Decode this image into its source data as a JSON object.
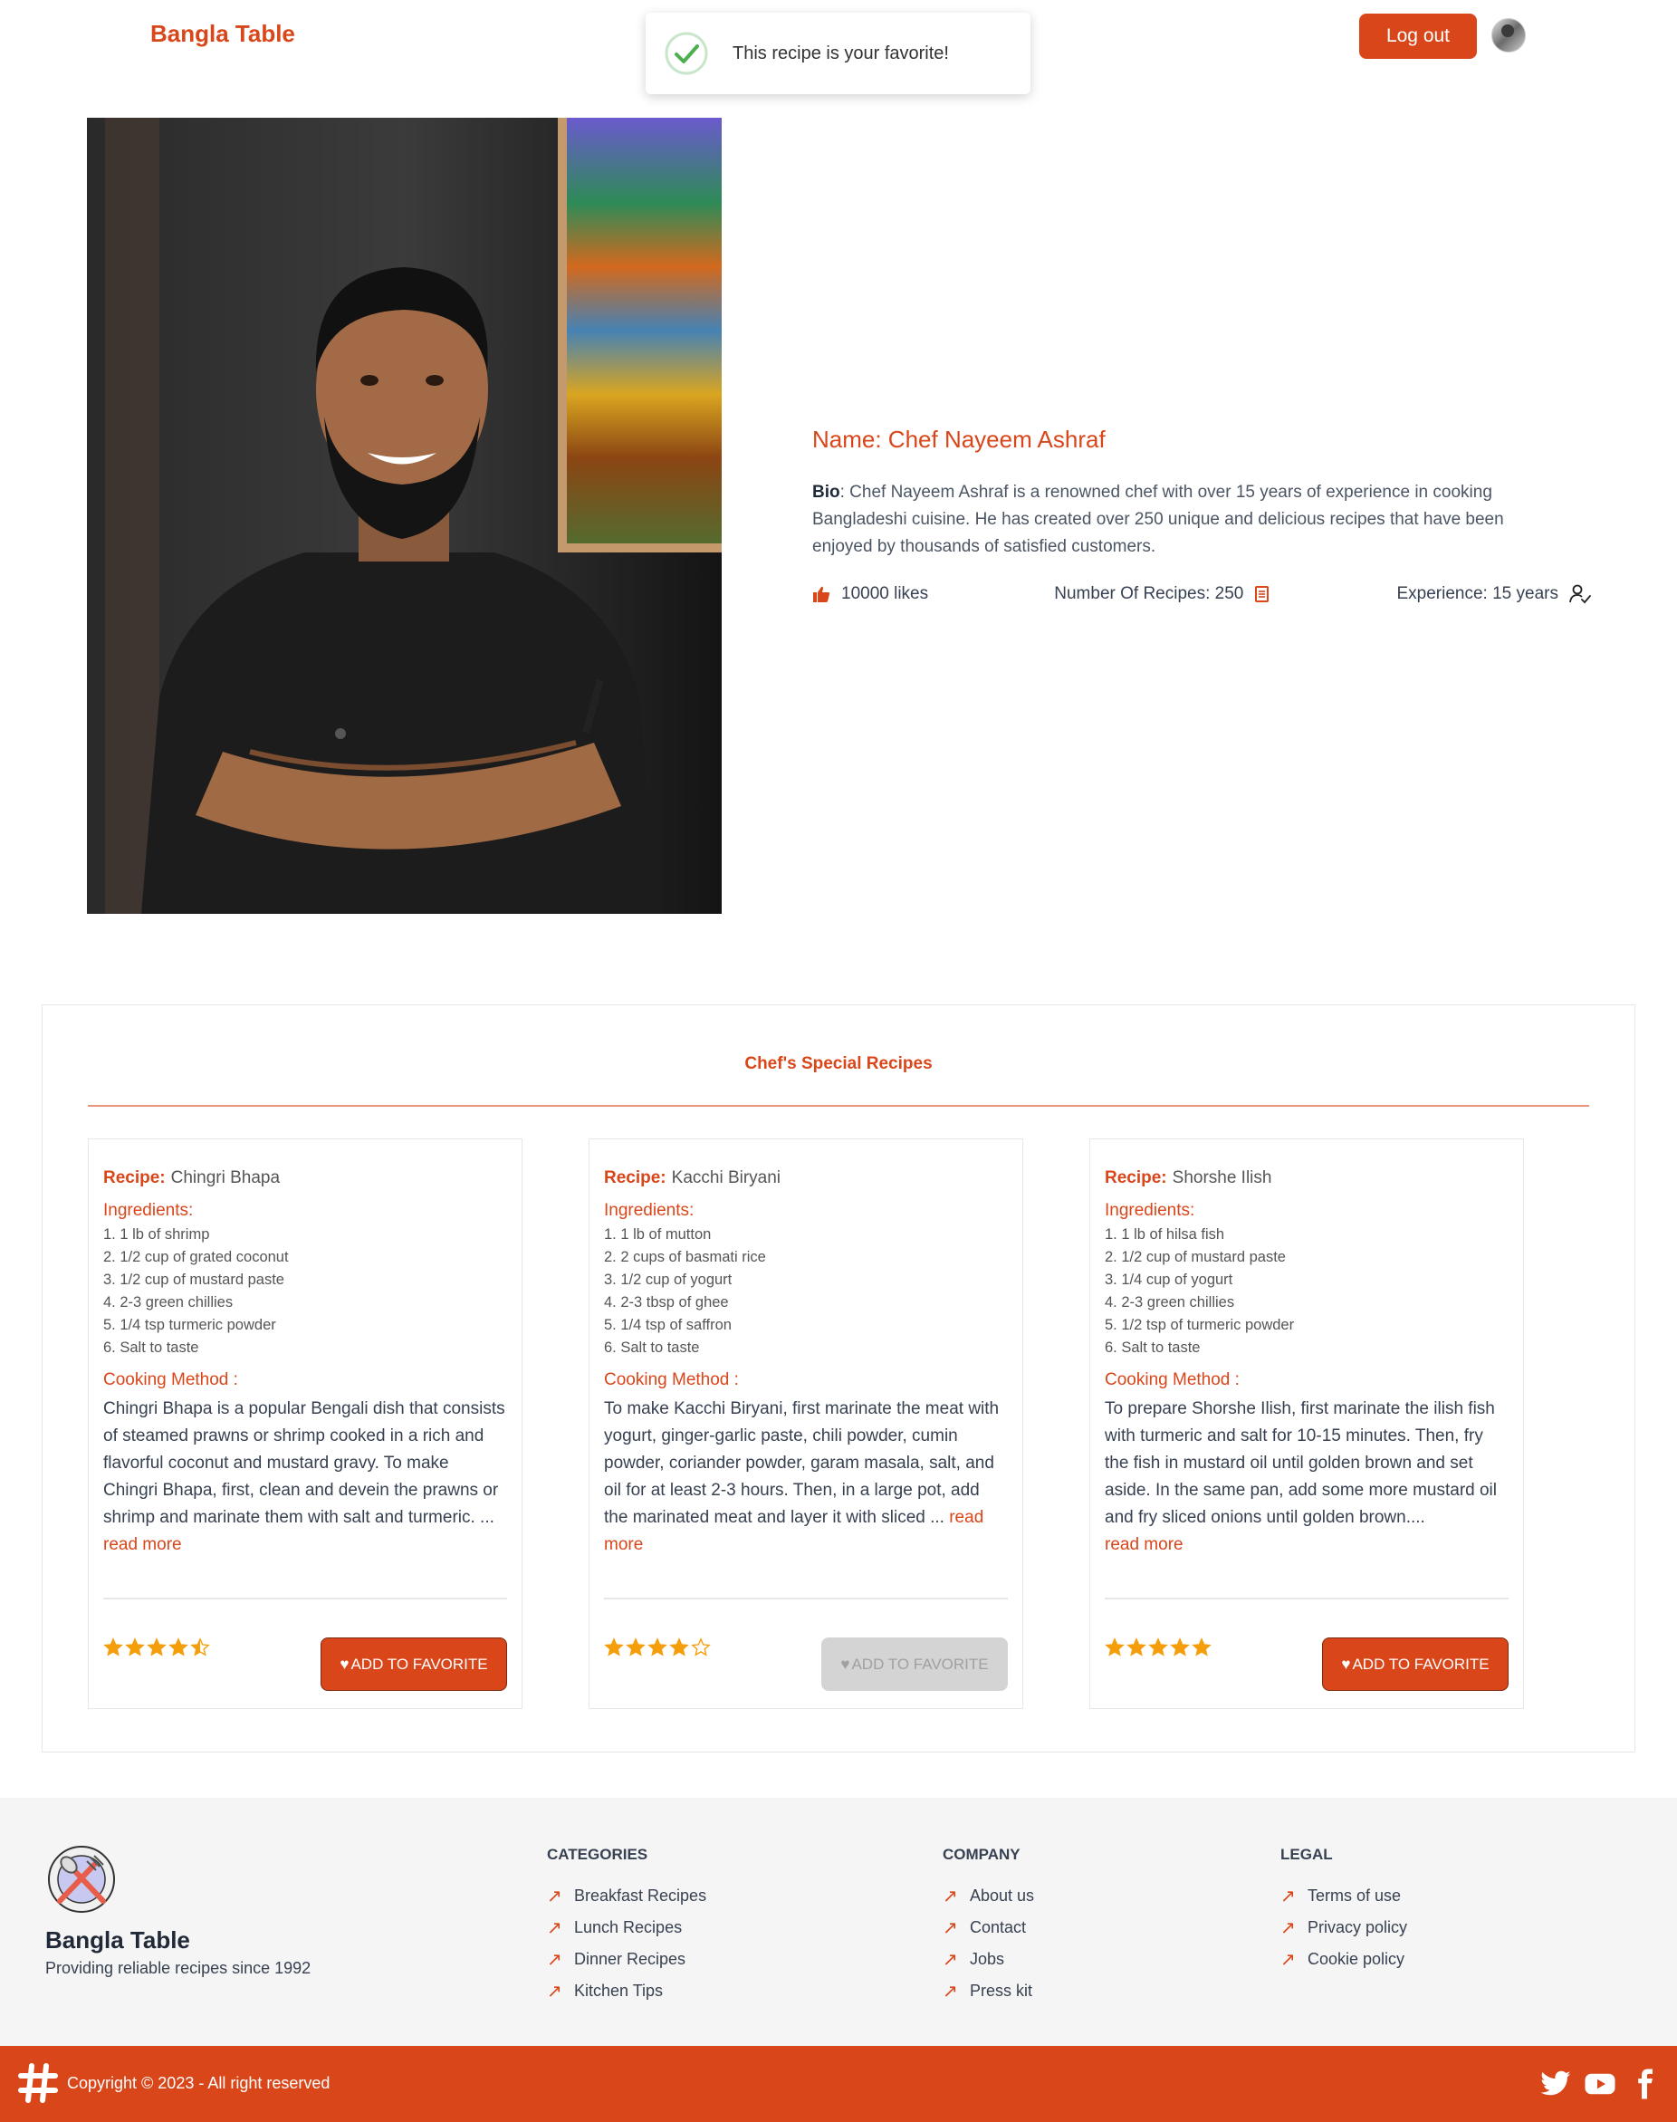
{
  "header": {
    "brand": "Bangla Table",
    "logout_label": "Log out"
  },
  "toast": {
    "message": "This recipe is your favorite!"
  },
  "chef": {
    "name": "Name: Chef Nayeem Ashraf",
    "bio_label": "Bio",
    "bio_text": ": Chef Nayeem Ashraf is a renowned chef with over 15 years of experience in cooking Bangladeshi cuisine. He has created over 250 unique and delicious recipes that have been enjoyed by thousands of satisfied customers.",
    "likes": "10000 likes",
    "recipes_count": "Number Of Recipes: 250",
    "experience": "Experience: 15 years"
  },
  "section": {
    "title": "Chef's Special Recipes"
  },
  "recipes": [
    {
      "label": "Recipe:",
      "name": "Chingri Bhapa",
      "ingredients_title": "Ingredients:",
      "ingredients": [
        "1. 1 lb of shrimp",
        "2. 1/2 cup of grated coconut",
        "3. 1/2 cup of mustard paste",
        "4. 2-3 green chillies",
        "5. 1/4 tsp turmeric powder",
        "6. Salt to taste"
      ],
      "method_title": "Cooking Method :",
      "method": "Chingri Bhapa is a popular Bengali dish that consists of steamed prawns or shrimp cooked in a rich and flavorful coconut and mustard gravy. To make Chingri Bhapa, first, clean and devein the prawns or shrimp and marinate them with salt and turmeric. ... ",
      "read_more": "read more",
      "rating": 4.5,
      "favorite_label": "ADD TO FAVORITE",
      "favorite_disabled": false
    },
    {
      "label": "Recipe:",
      "name": "Kacchi Biryani",
      "ingredients_title": "Ingredients:",
      "ingredients": [
        "1. 1 lb of mutton",
        "2. 2 cups of basmati rice",
        "3. 1/2 cup of yogurt",
        "4. 2-3 tbsp of ghee",
        "5. 1/4 tsp of saffron",
        "6. Salt to taste"
      ],
      "method_title": "Cooking Method :",
      "method": "To make Kacchi Biryani, first marinate the meat with yogurt, ginger-garlic paste, chili powder, cumin powder, coriander powder, garam masala, salt, and oil for at least 2-3 hours. Then, in a large pot, add the marinated meat and layer it with sliced ... ",
      "read_more": "read more",
      "rating": 4,
      "favorite_label": "ADD TO FAVORITE",
      "favorite_disabled": true
    },
    {
      "label": "Recipe:",
      "name": "Shorshe Ilish",
      "ingredients_title": "Ingredients:",
      "ingredients": [
        "1. 1 lb of hilsa fish",
        "2. 1/2 cup of mustard paste",
        "3. 1/4 cup of yogurt",
        "4. 2-3 green chillies",
        "5. 1/2 tsp of turmeric powder",
        "6. Salt to taste"
      ],
      "method_title": "Cooking Method :",
      "method": "To prepare Shorshe Ilish, first marinate the ilish fish with turmeric and salt for 10-15 minutes. Then, fry the fish in mustard oil until golden brown and set aside. In the same pan, add some more mustard oil and fry sliced onions until golden brown.... ",
      "read_more": "read more",
      "rating": 5,
      "favorite_label": "ADD TO FAVORITE",
      "favorite_disabled": false
    }
  ],
  "footer": {
    "brand": "Bangla Table",
    "tagline": "Providing reliable recipes since 1992",
    "columns": [
      {
        "title": "CATEGORIES",
        "links": [
          "Breakfast Recipes",
          "Lunch Recipes",
          "Dinner Recipes",
          "Kitchen Tips"
        ]
      },
      {
        "title": "COMPANY",
        "links": [
          "About us",
          "Contact",
          "Jobs",
          "Press kit"
        ]
      },
      {
        "title": "LEGAL",
        "links": [
          "Terms of use",
          "Privacy policy",
          "Cookie policy"
        ]
      }
    ],
    "copyright": "Copyright © 2023 - All right reserved"
  },
  "colors": {
    "accent": "#d9461a",
    "footer_bg": "#f5f5f5",
    "star": "#f59e0b"
  }
}
